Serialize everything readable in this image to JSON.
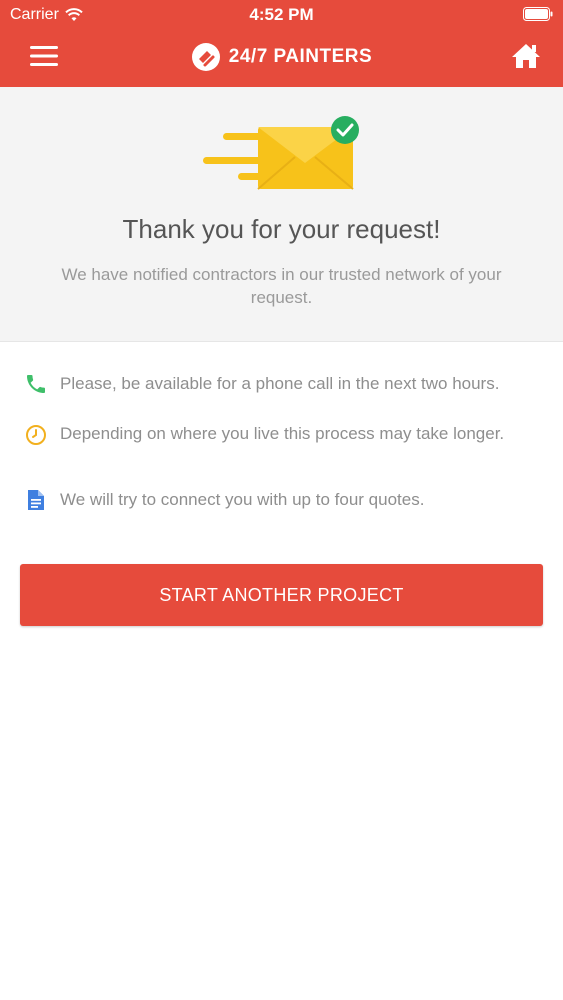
{
  "status_bar": {
    "carrier": "Carrier",
    "time": "4:52 PM"
  },
  "navbar": {
    "brand": "24/7 PAINTERS",
    "menu_icon": "hamburger-menu-icon",
    "home_icon": "home-icon"
  },
  "hero": {
    "title": "Thank you for your request!",
    "subtitle": "We have notified contractors in our trusted network of your request."
  },
  "info_items": [
    {
      "icon": "phone-icon",
      "color": "#3fbf6a",
      "text": "Please, be available for a phone call in the next two hours."
    },
    {
      "icon": "clock-icon",
      "color": "#f2b01e",
      "text": "Depending on where you live this process may take longer."
    },
    {
      "icon": "document-icon",
      "color": "#3f7fe0",
      "text": "We will try to connect you with up to four quotes."
    }
  ],
  "cta": {
    "label": "START ANOTHER PROJECT"
  },
  "colors": {
    "brand": "#e64b3c",
    "hero_bg": "#f4f4f4",
    "envelope": "#f7c21a",
    "check": "#27ae60"
  }
}
